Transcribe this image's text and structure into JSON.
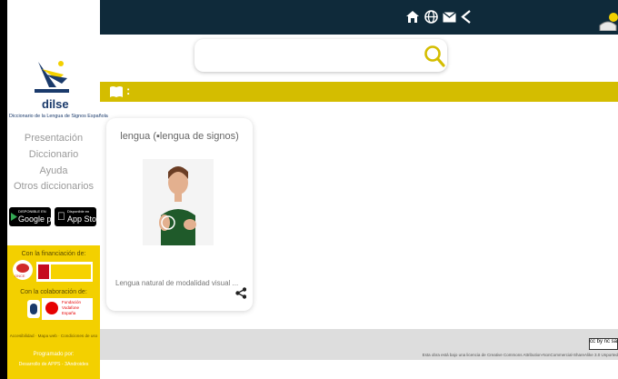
{
  "sidebar": {
    "brand": "dilse",
    "brand_sub": "Diccionario de la Lengua de Signos Española",
    "nav": [
      "Presentación",
      "Diccionario",
      "Ayuda",
      "Otros diccionarios"
    ],
    "google_small": "DISPONIBLE EN",
    "google_big": "Google play",
    "apple_small": "Disponible en",
    "apple_big": "App Store",
    "funding_label": "Con la financiación de:",
    "collab_label": "Con la colaboración de:",
    "vodafone": "Fundación Vodafone España",
    "links": "Accesibilidad · Mapa web · Condiciones de uso",
    "programmed_label": "Programado por:",
    "programmed_by": "Desarrollo de APPS - 3Androides"
  },
  "search": {
    "placeholder": "",
    "value": ""
  },
  "section": {
    "label": ":"
  },
  "result": {
    "title": "lengua (▪lengua de signos)",
    "description": "Lengua natural de modalidad visual ..."
  },
  "footer": {
    "license": "Esta obra está bajo una licencia de Creative Commons Attribution-NonCommercial-ShareAlike 3.0 Unported",
    "cc_badge": "cc by nc sa"
  },
  "icons": {
    "top": [
      "home-icon",
      "globe-icon",
      "mail-icon",
      "share-icon"
    ]
  },
  "colors": {
    "topbar": "#0f2a3a",
    "accent_yellow": "#d4bd00",
    "sidebar_yellow": "#f3d000"
  }
}
